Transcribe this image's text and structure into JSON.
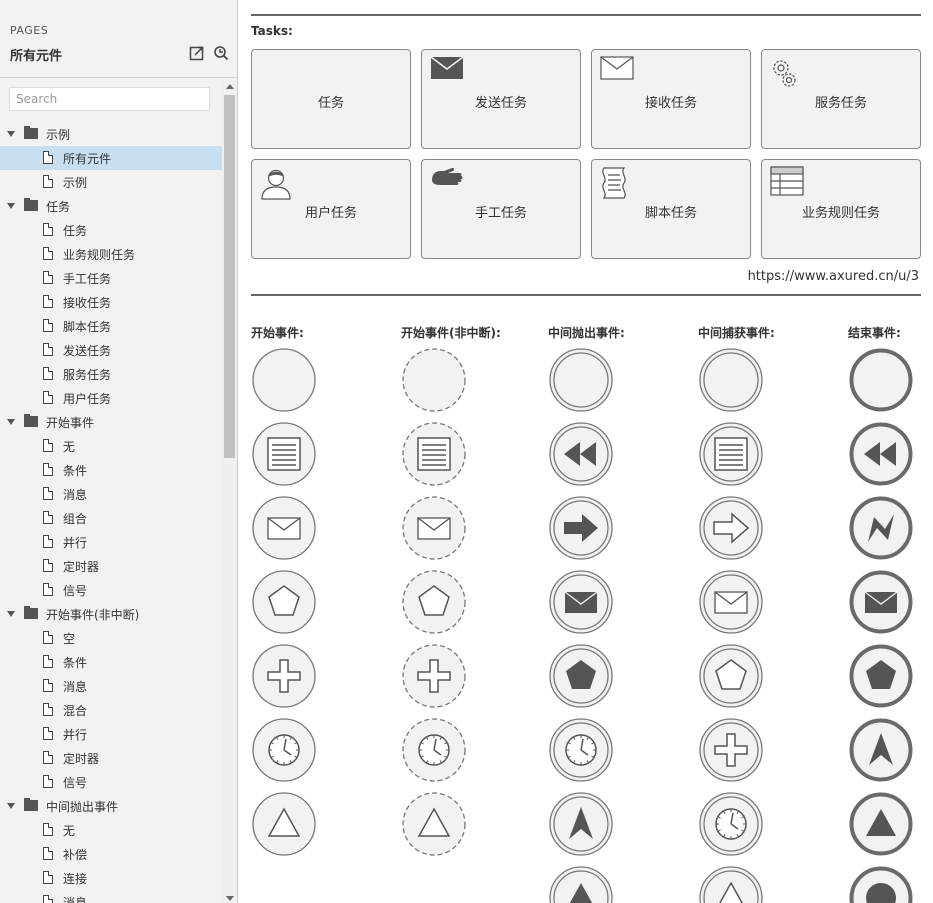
{
  "sidebar": {
    "caption": "PAGES",
    "title": "所有元件",
    "search_placeholder": "Search",
    "tree": [
      {
        "type": "folder",
        "label": "示例"
      },
      {
        "type": "page",
        "label": "所有元件",
        "selected": true
      },
      {
        "type": "page",
        "label": "示例"
      },
      {
        "type": "folder",
        "label": "任务"
      },
      {
        "type": "page",
        "label": "任务"
      },
      {
        "type": "page",
        "label": "业务规则任务"
      },
      {
        "type": "page",
        "label": "手工任务"
      },
      {
        "type": "page",
        "label": "接收任务"
      },
      {
        "type": "page",
        "label": "脚本任务"
      },
      {
        "type": "page",
        "label": "发送任务"
      },
      {
        "type": "page",
        "label": "服务任务"
      },
      {
        "type": "page",
        "label": "用户任务"
      },
      {
        "type": "folder",
        "label": "开始事件"
      },
      {
        "type": "page",
        "label": "无"
      },
      {
        "type": "page",
        "label": "条件"
      },
      {
        "type": "page",
        "label": "消息"
      },
      {
        "type": "page",
        "label": "组合"
      },
      {
        "type": "page",
        "label": "并行"
      },
      {
        "type": "page",
        "label": "定时器"
      },
      {
        "type": "page",
        "label": "信号"
      },
      {
        "type": "folder",
        "label": "开始事件(非中断)"
      },
      {
        "type": "page",
        "label": "空"
      },
      {
        "type": "page",
        "label": "条件"
      },
      {
        "type": "page",
        "label": "消息"
      },
      {
        "type": "page",
        "label": "混合"
      },
      {
        "type": "page",
        "label": "并行"
      },
      {
        "type": "page",
        "label": "定时器"
      },
      {
        "type": "page",
        "label": "信号"
      },
      {
        "type": "folder",
        "label": "中间抛出事件"
      },
      {
        "type": "page",
        "label": "无"
      },
      {
        "type": "page",
        "label": "补偿"
      },
      {
        "type": "page",
        "label": "连接"
      },
      {
        "type": "page",
        "label": "消息"
      }
    ]
  },
  "main": {
    "tasks_label": "Tasks:",
    "tasks": [
      {
        "label": "任务",
        "icon": "none"
      },
      {
        "label": "发送任务",
        "icon": "send-envelope-icon"
      },
      {
        "label": "接收任务",
        "icon": "receive-envelope-icon"
      },
      {
        "label": "服务任务",
        "icon": "gears-icon"
      },
      {
        "label": "用户任务",
        "icon": "user-icon"
      },
      {
        "label": "手工任务",
        "icon": "hand-icon"
      },
      {
        "label": "脚本任务",
        "icon": "script-icon"
      },
      {
        "label": "业务规则任务",
        "icon": "table-icon"
      }
    ],
    "url": "https://www.axured.cn/u/3",
    "event_columns": [
      {
        "label": "开始事件:",
        "style": "start",
        "icons": [
          "none",
          "conditional",
          "message",
          "multiple",
          "parallel",
          "timer",
          "signal"
        ]
      },
      {
        "label": "开始事件(非中断):",
        "style": "dashed",
        "icons": [
          "none",
          "conditional",
          "message",
          "multiple",
          "parallel",
          "timer",
          "signal"
        ]
      },
      {
        "label": "中间抛出事件:",
        "style": "double",
        "icons": [
          "none",
          "compensate-filled",
          "link-filled",
          "message-filled",
          "multiple-filled",
          "timer",
          "escalation-filled",
          "signal-filled"
        ]
      },
      {
        "label": "中间捕获事件:",
        "style": "double",
        "icons": [
          "none",
          "conditional",
          "link",
          "message",
          "multiple",
          "parallel",
          "timer",
          "signal"
        ]
      },
      {
        "label": "结束事件:",
        "style": "thick",
        "icons": [
          "none",
          "compensate-filled",
          "error-filled",
          "message-filled",
          "multiple-filled",
          "escalation-filled",
          "signal-filled",
          "terminate-filled"
        ]
      }
    ]
  }
}
